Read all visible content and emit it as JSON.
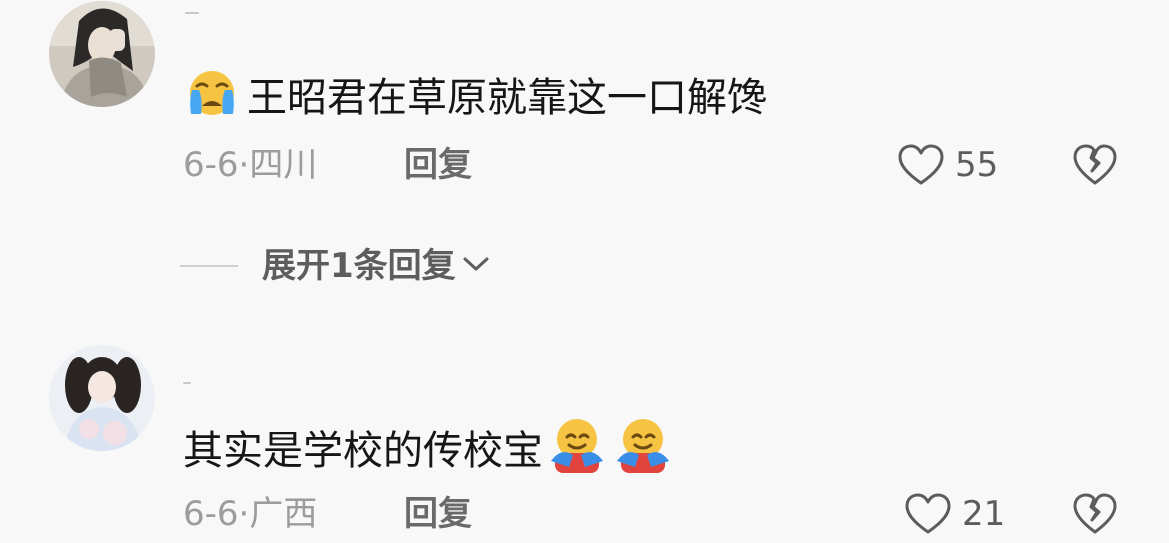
{
  "comments": [
    {
      "text": "王昭君在草原就靠这一口解馋",
      "lead_emoji": "crying-face",
      "date": "6-6·",
      "location": "四川",
      "reply_label": "回复",
      "likes": "55",
      "replies_expand_label": "展开1条回复"
    },
    {
      "text": "其实是学校的传校宝",
      "trailing_emoji": [
        "hugging-face",
        "hugging-face"
      ],
      "date": "6-6·",
      "location": "广西",
      "reply_label": "回复",
      "likes": "21"
    }
  ],
  "colors": {
    "background": "#f8f8f8",
    "text": "#161616",
    "meta": "#9c9c9c",
    "action": "#5c5c5c"
  }
}
